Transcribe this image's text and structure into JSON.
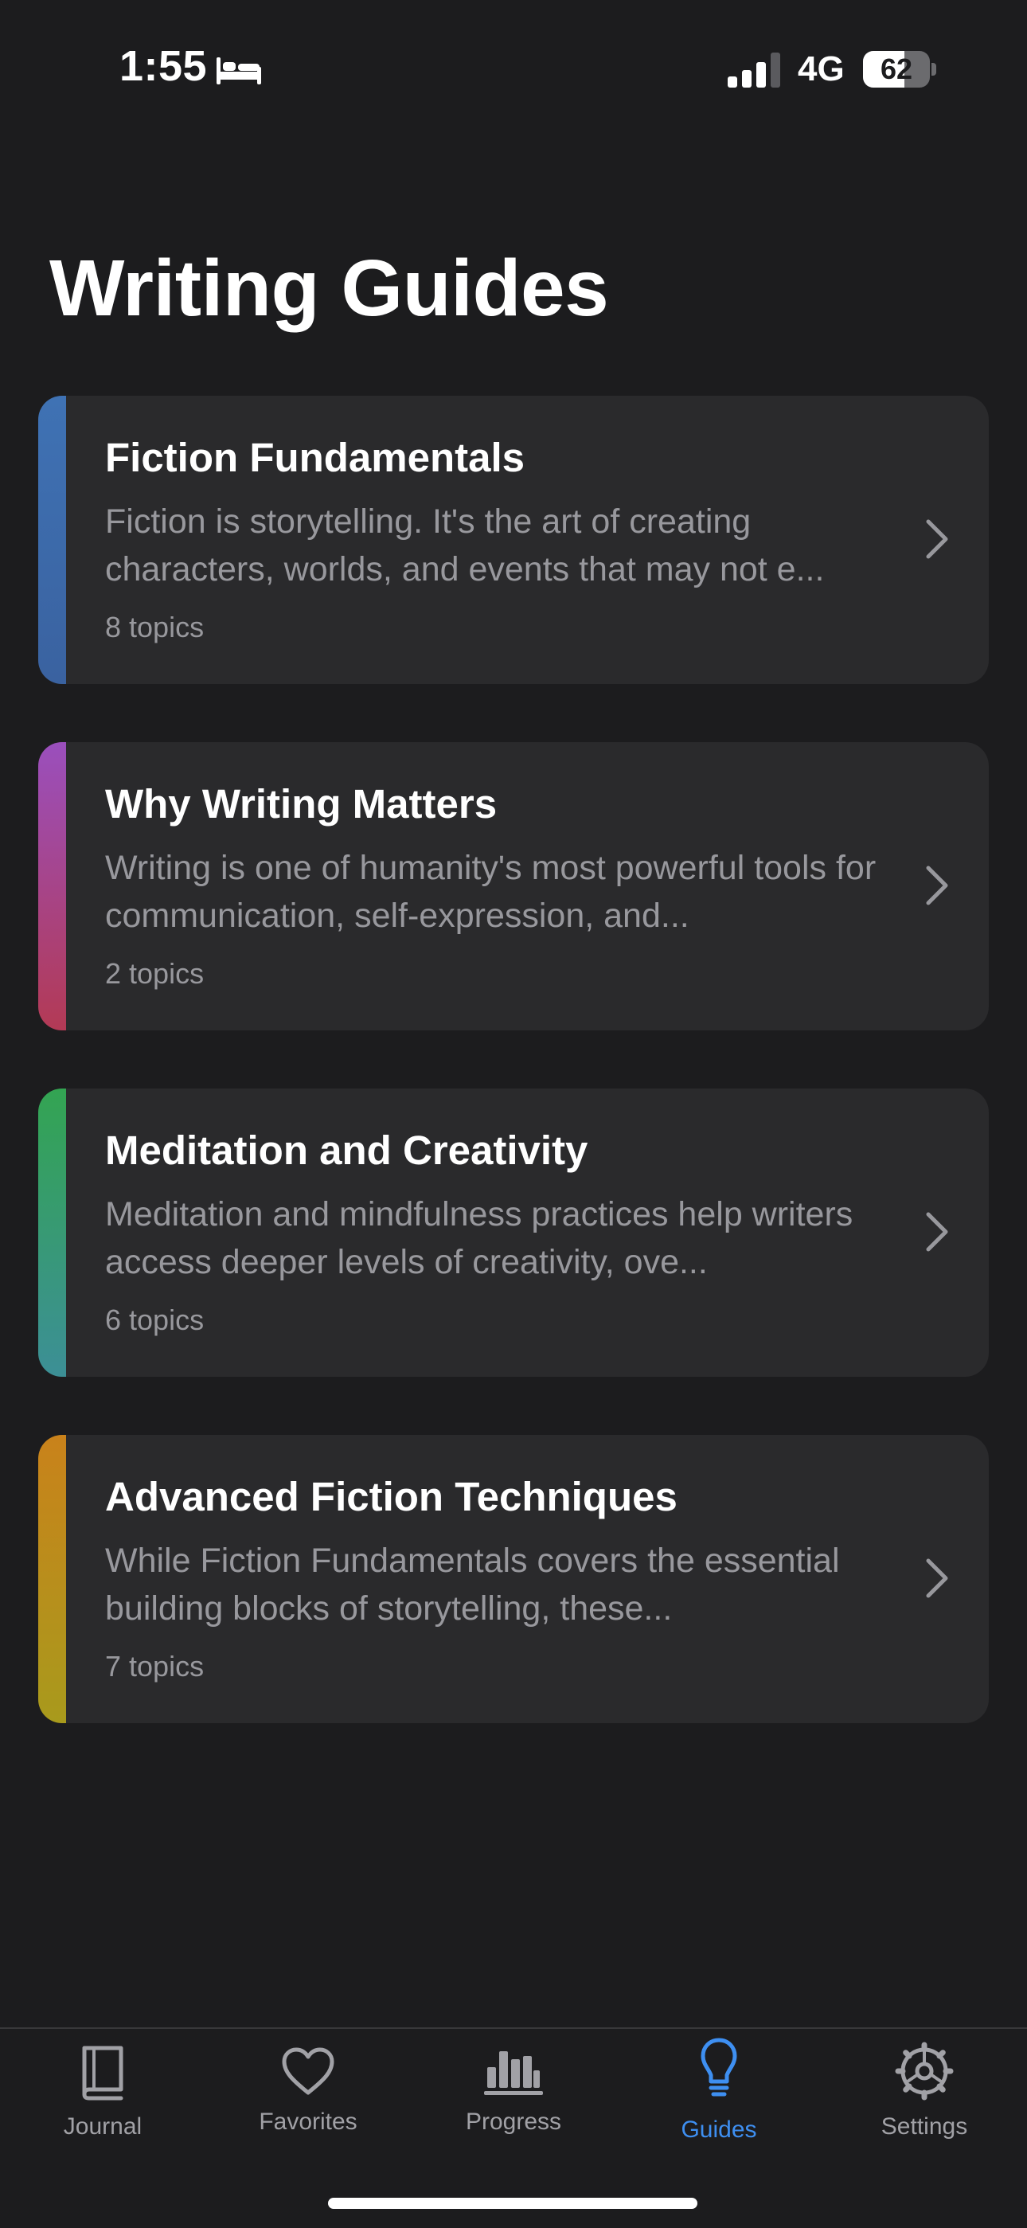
{
  "status_bar": {
    "time": "1:55",
    "network": "4G",
    "battery_level": "62",
    "battery_fraction": 0.62
  },
  "page": {
    "title": "Writing Guides"
  },
  "guides": [
    {
      "title": "Fiction Fundamentals",
      "description": "Fiction is storytelling. It's the art of creating characters, worlds, and events that may not e...",
      "topics": "8 topics",
      "accent_top": "#3f72b4",
      "accent_bottom": "#3a62a0"
    },
    {
      "title": "Why Writing Matters",
      "description": "Writing is one of humanity's most powerful tools for communication, self-expression, and...",
      "topics": "2 topics",
      "accent_top": "#9a4fbd",
      "accent_bottom": "#b33a55"
    },
    {
      "title": "Meditation and Creativity",
      "description": "Meditation and mindfulness practices help writers access deeper levels of creativity, ove...",
      "topics": "6 topics",
      "accent_top": "#33a452",
      "accent_bottom": "#3c8f96"
    },
    {
      "title": "Advanced Fiction Techniques",
      "description": "While Fiction Fundamentals covers the essential building blocks of storytelling, these...",
      "topics": "7 topics",
      "accent_top": "#c9821b",
      "accent_bottom": "#a89a1c"
    }
  ],
  "tab_bar": {
    "active": "Guides",
    "accent_color": "#3e8ff1",
    "tabs": [
      {
        "label": "Journal",
        "icon": "book-icon"
      },
      {
        "label": "Favorites",
        "icon": "heart-icon"
      },
      {
        "label": "Progress",
        "icon": "chart-icon"
      },
      {
        "label": "Guides",
        "icon": "lightbulb-icon"
      },
      {
        "label": "Settings",
        "icon": "gear-icon"
      }
    ]
  }
}
